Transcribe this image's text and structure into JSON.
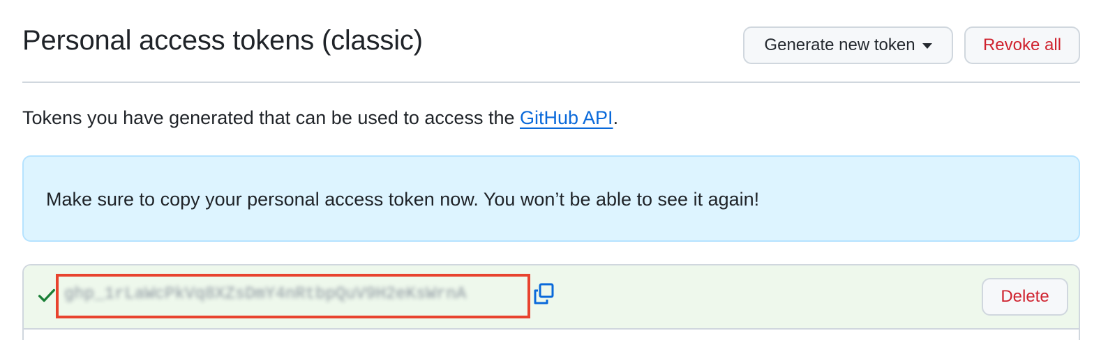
{
  "header": {
    "title": "Personal access tokens (classic)",
    "generate_button_label": "Generate new token",
    "revoke_all_label": "Revoke all"
  },
  "intro": {
    "text_before": "Tokens you have generated that can be used to access the ",
    "link_text": "GitHub API",
    "text_after": "."
  },
  "flash": {
    "message": "Make sure to copy your personal access token now. You won’t be able to see it again!"
  },
  "token": {
    "status_icon": "check-icon",
    "value": "ghp_1rLaWcPkVq8XZsDmY4nRtbpQuV9H2eKsWrnA",
    "copy_icon": "copy-icon",
    "delete_label": "Delete"
  },
  "colors": {
    "accent_link": "#0969da",
    "danger": "#cf222e",
    "success": "#1a7f37",
    "info_bg": "#ddf4ff",
    "success_bg": "#eef8ec",
    "highlight": "#e8432e"
  }
}
